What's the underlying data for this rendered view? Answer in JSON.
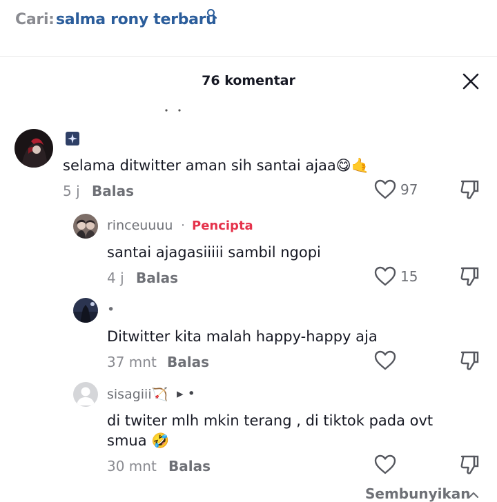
{
  "search": {
    "prefix": "Cari:",
    "query": "salma rony terbaru"
  },
  "comments_header": {
    "title": "76 komentar"
  },
  "comments": [
    {
      "username": "",
      "text": "selama ditwitter aman sih santai ajaa😋🤙",
      "time": "5 j",
      "reply_label": "Balas",
      "likes": "97"
    },
    {
      "username": "rinceuuuu",
      "separator": "·",
      "badge": "Pencipta",
      "text": "santai ajagasiiiii sambil ngopi",
      "time": "4 j",
      "reply_label": "Balas",
      "likes": "15"
    },
    {
      "username": "•",
      "text": "Ditwitter kita malah happy-happy aja",
      "time": "37 mnt",
      "reply_label": "Balas",
      "likes": ""
    },
    {
      "username": "sisagiii🏹",
      "username_suffix": "▸ •",
      "text_line1": "di twiter mlh mkin terang , di tiktok pada ovt",
      "text_line2": "smua 🤣",
      "time": "30 mnt",
      "reply_label": "Balas",
      "likes": ""
    }
  ],
  "footer": {
    "collapse_label": "Sembunyikan"
  },
  "colors": {
    "query": "#2b5d9b",
    "creator_badge": "#e5324b",
    "muted": "#8a8b91"
  }
}
